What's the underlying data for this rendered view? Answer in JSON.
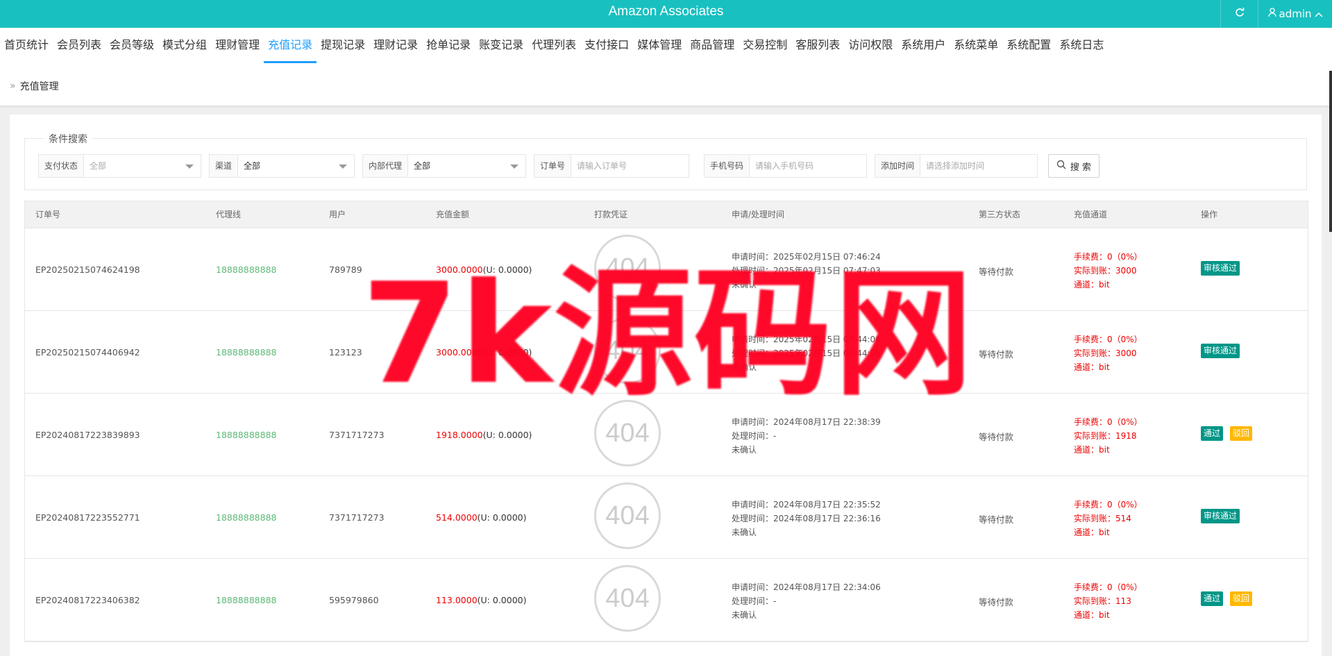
{
  "app": {
    "title": "Amazon Associates",
    "user_label": "admin"
  },
  "icons": {
    "refresh": "refresh-icon",
    "user": "user-icon",
    "user_caret": "chevron-up-icon",
    "search": "search-icon",
    "breadcrumb": "double-chevron-right-icon"
  },
  "nav": {
    "items": [
      "首页统计",
      "会员列表",
      "会员等级",
      "模式分组",
      "理财管理",
      "充值记录",
      "提现记录",
      "理财记录",
      "抢单记录",
      "账变记录",
      "代理列表",
      "支付接口",
      "媒体管理",
      "商品管理",
      "交易控制",
      "客服列表",
      "访问权限",
      "系统用户",
      "系统菜单",
      "系统配置",
      "系统日志"
    ],
    "active_index": 5
  },
  "breadcrumb": {
    "current": "充值管理"
  },
  "search": {
    "legend": "条件搜索",
    "pay_status": {
      "label": "支付状态",
      "value": "全部"
    },
    "channel": {
      "label": "渠道",
      "value": "全部"
    },
    "internal_agent": {
      "label": "内部代理",
      "value": "全部"
    },
    "order_no": {
      "label": "订单号",
      "placeholder": "请输入订单号"
    },
    "phone": {
      "label": "手机号码",
      "placeholder": "请输入手机号码"
    },
    "add_time": {
      "label": "添加时间",
      "placeholder": "请选择添加时间"
    },
    "button": "搜 索"
  },
  "table": {
    "columns": [
      "订单号",
      "代理线",
      "用户",
      "充值金额",
      "打款凭证",
      "申请/处理时间",
      "第三方状态",
      "充值通道",
      "操作"
    ],
    "rows": [
      {
        "order": "EP20250215074624198",
        "agent": "18888888888",
        "user": "789789",
        "amount": "3000.0000",
        "usdt": "(U: 0.0000)",
        "proof": "404",
        "apply": "申请时间：2025年02月15日 07:46:24",
        "process": "处理时间：2025年02月15日 07:47:03",
        "confirm": "未确认",
        "third": "等待付款",
        "fee": "手续费：0（0%）",
        "actual": "实际到账：3000",
        "channel": "通道：bit",
        "buttons": [
          "审核通过"
        ]
      },
      {
        "order": "EP20250215074406942",
        "agent": "18888888888",
        "user": "123123",
        "amount": "3000.0000",
        "usdt": "(U: 0.0000)",
        "proof": "404",
        "apply": "申请时间：2025年02月15日 07:44:06",
        "process": "处理时间：2025年02月15日 07:44:56",
        "confirm": "未确认",
        "third": "等待付款",
        "fee": "手续费：0（0%）",
        "actual": "实际到账：3000",
        "channel": "通道：bit",
        "buttons": [
          "审核通过"
        ]
      },
      {
        "order": "EP20240817223839893",
        "agent": "18888888888",
        "user": "7371717273",
        "amount": "1918.0000",
        "usdt": "(U: 0.0000)",
        "proof": "404",
        "apply": "申请时间：2024年08月17日 22:38:39",
        "process": "处理时间：-",
        "confirm": "未确认",
        "third": "等待付款",
        "fee": "手续费：0（0%）",
        "actual": "实际到账：1918",
        "channel": "通道：bit",
        "buttons": [
          "通过",
          "驳回"
        ]
      },
      {
        "order": "EP20240817223552771",
        "agent": "18888888888",
        "user": "7371717273",
        "amount": "514.0000",
        "usdt": "(U: 0.0000)",
        "proof": "404",
        "apply": "申请时间：2024年08月17日 22:35:52",
        "process": "处理时间：2024年08月17日 22:36:16",
        "confirm": "未确认",
        "third": "等待付款",
        "fee": "手续费：0（0%）",
        "actual": "实际到账：514",
        "channel": "通道：bit",
        "buttons": [
          "审核通过"
        ]
      },
      {
        "order": "EP20240817223406382",
        "agent": "18888888888",
        "user": "595979860",
        "amount": "113.0000",
        "usdt": "(U: 0.0000)",
        "proof": "404",
        "apply": "申请时间：2024年08月17日 22:34:06",
        "process": "处理时间：-",
        "confirm": "未确认",
        "third": "等待付款",
        "fee": "手续费：0（0%）",
        "actual": "实际到账：113",
        "channel": "通道：bit",
        "buttons": [
          "通过",
          "驳回"
        ]
      }
    ]
  },
  "watermark": {
    "text": "7k源码网"
  },
  "colors": {
    "topbar": "#19c0c0",
    "active_nav": "#1e9fff",
    "agent": "#5fb878",
    "amount": "#e00000",
    "btn_green": "#009688",
    "btn_yellow": "#ffb800",
    "watermark": "#ff0022"
  }
}
